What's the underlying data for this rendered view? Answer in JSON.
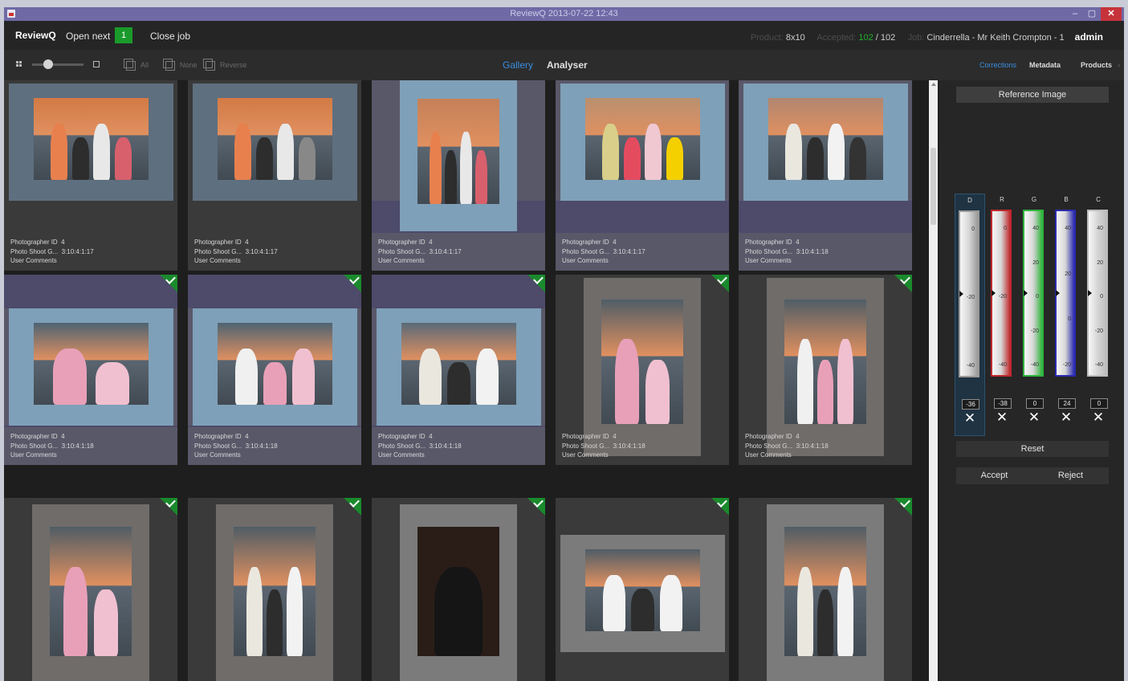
{
  "window": {
    "title": "ReviewQ 2013-07-22 12:43",
    "controls": {
      "minimize": "–",
      "maximize": "▢",
      "close": "✕"
    }
  },
  "topbar": {
    "brand": "ReviewQ",
    "open_next_label": "Open next",
    "open_next_count": "1",
    "close_job_label": "Close job",
    "product_label": "Product:",
    "product_value": "8x10",
    "accepted_label": "Accepted:",
    "accepted_value": "102",
    "accepted_sep": "/",
    "accepted_total": "102",
    "job_label": "Job:",
    "job_value": "Cinderrella - Mr Keith Crompton - 1",
    "user": "admin"
  },
  "toolbar": {
    "select_all": "All",
    "select_none": "None",
    "select_reverse": "Reverse",
    "zoom_level": 0.3,
    "tabs": {
      "gallery": "Gallery",
      "analyser": "Analyser"
    },
    "right_tabs": {
      "corrections": "Corrections",
      "metadata": "Metadata",
      "products": "Products",
      "more": "›"
    }
  },
  "gallery": {
    "labels": {
      "photographer": "Photographer ID",
      "photoshoot": "Photo Shoot G...",
      "comments": "User Comments"
    },
    "photos": [
      {
        "photographer_id": "4",
        "photoshoot": "3:10:4:1:17",
        "accepted": false,
        "selected": false
      },
      {
        "photographer_id": "4",
        "photoshoot": "3:10:4:1:17",
        "accepted": false,
        "selected": false
      },
      {
        "photographer_id": "4",
        "photoshoot": "3:10:4:1:17",
        "accepted": false,
        "selected": true
      },
      {
        "photographer_id": "4",
        "photoshoot": "3:10:4:1:17",
        "accepted": false,
        "selected": true
      },
      {
        "photographer_id": "4",
        "photoshoot": "3:10:4:1:18",
        "accepted": false,
        "selected": true
      },
      {
        "photographer_id": "4",
        "photoshoot": "3:10:4:1:18",
        "accepted": true,
        "selected": true
      },
      {
        "photographer_id": "4",
        "photoshoot": "3:10:4:1:18",
        "accepted": true,
        "selected": true
      },
      {
        "photographer_id": "4",
        "photoshoot": "3:10:4:1:18",
        "accepted": true,
        "selected": true
      },
      {
        "photographer_id": "4",
        "photoshoot": "3:10:4:1:18",
        "accepted": true,
        "selected": false
      },
      {
        "photographer_id": "4",
        "photoshoot": "3:10:4:1:18",
        "accepted": true,
        "selected": false
      },
      {
        "accepted": true,
        "selected": false
      },
      {
        "accepted": true,
        "selected": false
      },
      {
        "accepted": true,
        "selected": false
      },
      {
        "accepted": true,
        "selected": false
      },
      {
        "accepted": true,
        "selected": false
      }
    ]
  },
  "corrections": {
    "reference_button": "Reference Image",
    "channels": [
      {
        "key": "D",
        "color": "#9a9a9a",
        "ticks": [
          "0",
          "-20",
          "-40"
        ],
        "value": "-36",
        "level": 0.5,
        "selected": true
      },
      {
        "key": "R",
        "color": "#c0282d",
        "ticks": [
          "0",
          "-20",
          "-40"
        ],
        "value": "-38",
        "level": 0.5,
        "selected": false
      },
      {
        "key": "G",
        "color": "#2fb43c",
        "ticks": [
          "40",
          "20",
          "0",
          "-20",
          "-40"
        ],
        "value": "0",
        "level": 0.5,
        "selected": false
      },
      {
        "key": "B",
        "color": "#2a2ab0",
        "ticks": [
          "40",
          "20",
          "0",
          "-20"
        ],
        "value": "24",
        "level": 0.5,
        "selected": false
      },
      {
        "key": "C",
        "color": "#bdbdbd",
        "ticks": [
          "40",
          "20",
          "0",
          "-20",
          "-40"
        ],
        "value": "0",
        "level": 0.5,
        "selected": false
      }
    ],
    "clear_symbol": "✕",
    "reset_button": "Reset",
    "accept_button": "Accept",
    "reject_button": "Reject"
  }
}
